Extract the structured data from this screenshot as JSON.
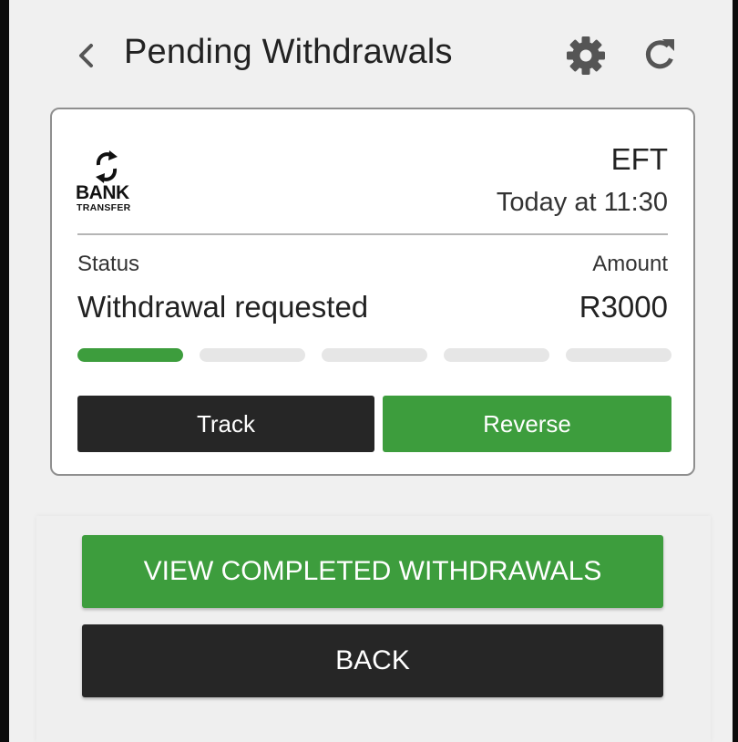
{
  "header": {
    "title": "Pending Withdrawals",
    "back_icon": "chevron-left-icon",
    "settings_icon": "gear-icon",
    "refresh_icon": "refresh-icon"
  },
  "withdrawal": {
    "logo": {
      "line1": "BANK",
      "line2": "TRANSFER",
      "icon": "bank-transfer-arrows-icon"
    },
    "method": "EFT",
    "time": "Today at 11:30",
    "status_label": "Status",
    "status_value": "Withdrawal requested",
    "amount_label": "Amount",
    "amount_value": "R3000",
    "progress": {
      "completed_steps": 1,
      "total_steps": 5
    },
    "track_label": "Track",
    "reverse_label": "Reverse"
  },
  "actions": {
    "view_completed_label": "VIEW COMPLETED WITHDRAWALS",
    "back_label": "BACK"
  },
  "colors": {
    "accent_green": "#3d9d3d",
    "dark_button": "#262626",
    "progress_inactive": "#e6e6e6",
    "background": "#f0f0f0"
  }
}
